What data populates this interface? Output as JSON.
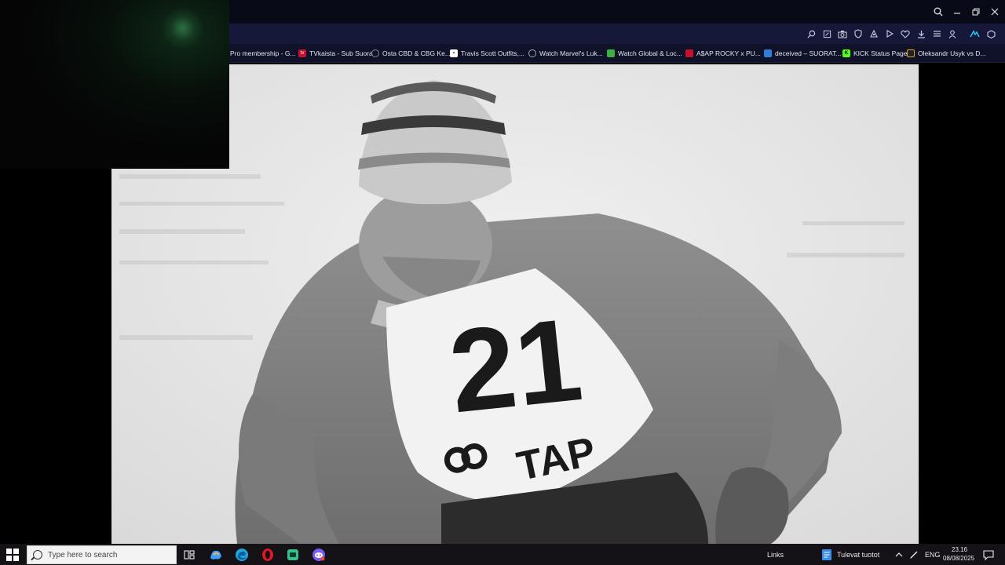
{
  "bookmarks": [
    {
      "label": "Pro membership - G...",
      "icon": "bookmark-icon",
      "color": "#2a2d45"
    },
    {
      "label": "TVkaista - Sub Suora",
      "icon": "tvkaista-icon",
      "color": "#c8102e"
    },
    {
      "label": "Osta CBD & CBG Ke...",
      "icon": "globe-icon",
      "color": "#555"
    },
    {
      "label": "Travis Scott Outfits,...",
      "icon": "page-icon",
      "color": "#ffffff"
    },
    {
      "label": "Watch Marvel's Luk...",
      "icon": "globe-icon",
      "color": "#777"
    },
    {
      "label": "Watch Global & Loc...",
      "icon": "tv-icon",
      "color": "#3cb043"
    },
    {
      "label": "A$AP ROCKY x PU...",
      "icon": "puma-icon",
      "color": "#c8102e"
    },
    {
      "label": "deceived – SUORAT...",
      "icon": "image-icon",
      "color": "#2f7fd8"
    },
    {
      "label": "KICK Status Page",
      "icon": "kick-icon",
      "color": "#53fc18"
    },
    {
      "label": "Oleksandr Usyk vs D...",
      "icon": "bookmark-icon",
      "color": "#e0a020"
    }
  ],
  "photo": {
    "bib_number": "21",
    "bib_sponsor": "TAP"
  },
  "taskbar": {
    "search_placeholder": "Type here to search",
    "links_label": "Links",
    "news_label": "Tulevat tuotot",
    "lang": "ENG",
    "time": "23.16",
    "date": "08/08/2025"
  },
  "colors": {
    "titlebar_bg": "#090a18",
    "toolbar_bg": "#151838",
    "bookmarks_bg": "#10122a",
    "taskbar_bg": "#141117",
    "accent": "#00a8e8"
  }
}
